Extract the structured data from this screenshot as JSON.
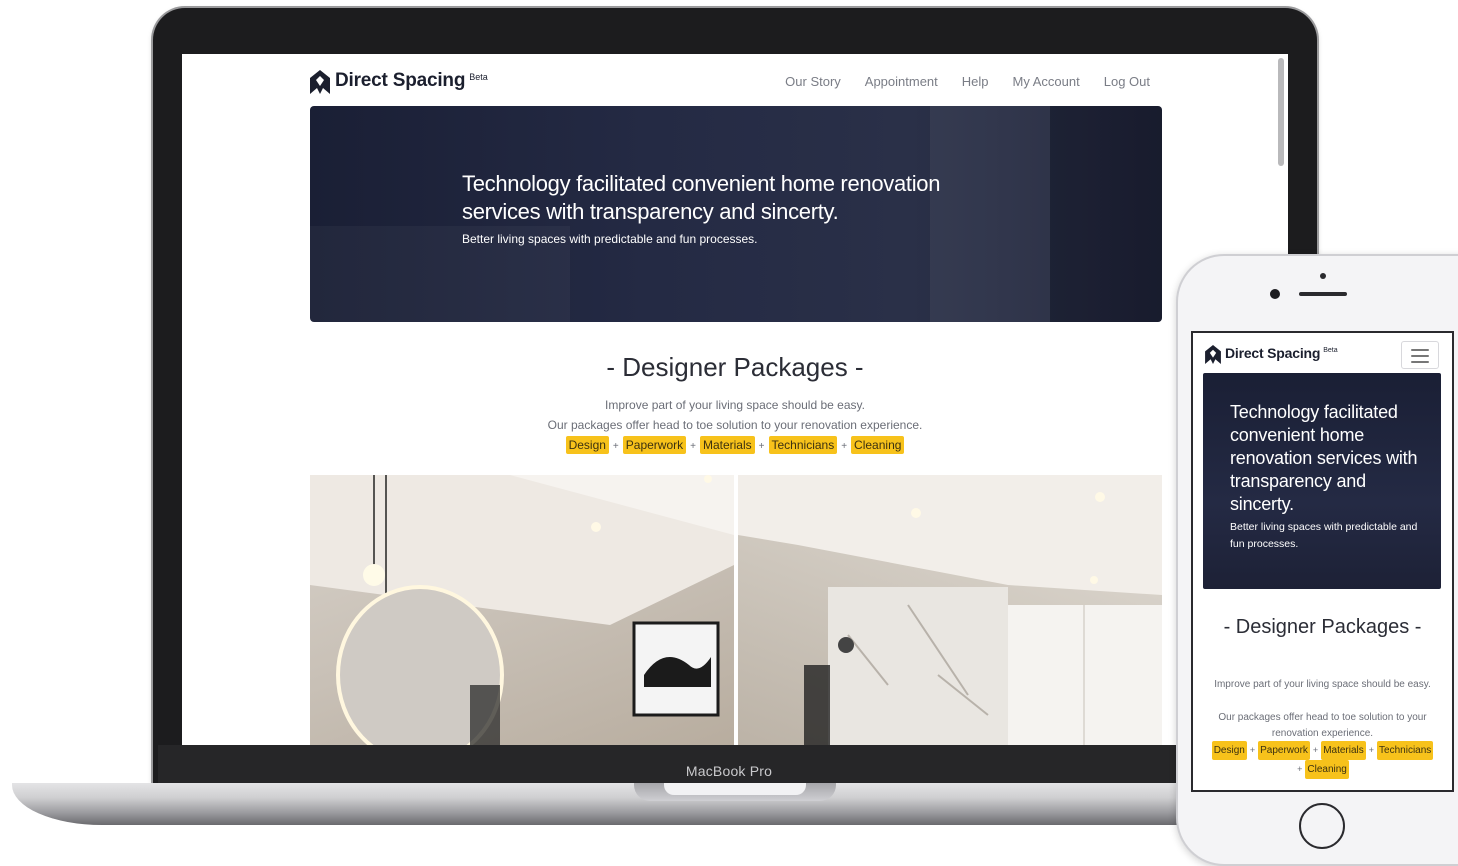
{
  "device_label": "MacBook Pro",
  "site": {
    "brand": "Direct Spacing",
    "beta": "Beta",
    "nav": [
      "Our Story",
      "Appointment",
      "Help",
      "My Account",
      "Log Out"
    ],
    "hero": {
      "title": "Technology facilitated convenient home renovation services with transparency and sincerty.",
      "subtitle": "Better living spaces with predictable and fun processes."
    },
    "packages": {
      "title": "- Designer Packages -",
      "line1": "Improve part of your living space should be easy.",
      "line2": "Our packages offer head to toe solution to your renovation experience.",
      "tags": [
        "Design",
        "Paperwork",
        "Materials",
        "Technicians",
        "Cleaning"
      ],
      "separator": "+"
    }
  },
  "colors": {
    "hero_bg": "#1f2439",
    "tag_bg": "#f7c21b",
    "brand_text": "#1b1f2e",
    "nav_text": "#7a7d86"
  }
}
